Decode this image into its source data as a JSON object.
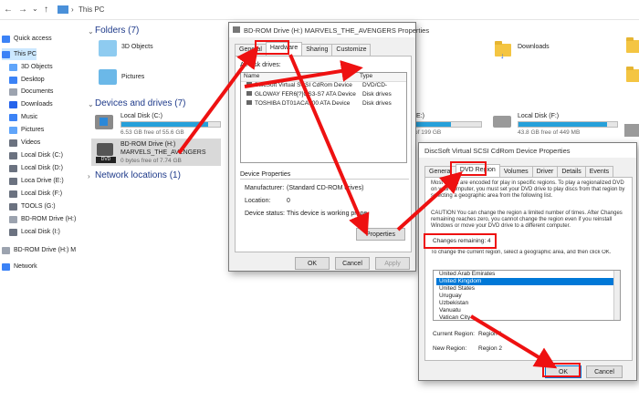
{
  "explorer": {
    "breadcrumb": "This PC",
    "sidebar": [
      {
        "label": "Quick access",
        "name": "sidebar-item-quick-access",
        "icon": "star-icon",
        "color": "#3b82f6"
      },
      {
        "label": "This PC",
        "name": "sidebar-item-this-pc",
        "icon": "pc-icon",
        "color": "#3b82f6",
        "selected": true
      },
      {
        "label": "3D Objects",
        "name": "sidebar-item-3d-objects",
        "icon": "cube-icon",
        "color": "#60a5fa"
      },
      {
        "label": "Desktop",
        "name": "sidebar-item-desktop",
        "icon": "desktop-icon",
        "color": "#3b82f6"
      },
      {
        "label": "Documents",
        "name": "sidebar-item-documents",
        "icon": "document-icon",
        "color": "#9ca3af"
      },
      {
        "label": "Downloads",
        "name": "sidebar-item-downloads",
        "icon": "download-icon",
        "color": "#2563eb"
      },
      {
        "label": "Music",
        "name": "sidebar-item-music",
        "icon": "music-icon",
        "color": "#3b82f6"
      },
      {
        "label": "Pictures",
        "name": "sidebar-item-pictures",
        "icon": "pictures-icon",
        "color": "#60a5fa"
      },
      {
        "label": "Videos",
        "name": "sidebar-item-videos",
        "icon": "video-icon",
        "color": "#6b7280"
      },
      {
        "label": "Local Disk (C:)",
        "name": "sidebar-item-local-c",
        "icon": "drive-icon",
        "color": "#6b7280"
      },
      {
        "label": "Local Disk (D:)",
        "name": "sidebar-item-local-d",
        "icon": "drive-icon",
        "color": "#6b7280"
      },
      {
        "label": "Loca Drive (E:)",
        "name": "sidebar-item-local-e",
        "icon": "drive-icon",
        "color": "#6b7280"
      },
      {
        "label": "Local Disk (F:)",
        "name": "sidebar-item-local-f",
        "icon": "drive-icon",
        "color": "#6b7280"
      },
      {
        "label": "TOOLS (G:)",
        "name": "sidebar-item-tools-g",
        "icon": "drive-icon",
        "color": "#6b7280"
      },
      {
        "label": "BD-ROM Drive (H:)",
        "name": "sidebar-item-bd-h",
        "icon": "disc-icon",
        "color": "#9ca3af"
      },
      {
        "label": "Local Disk (I:)",
        "name": "sidebar-item-local-i",
        "icon": "drive-icon",
        "color": "#6b7280"
      },
      {
        "label": "BD-ROM Drive (H:) M",
        "name": "sidebar-item-bd-h-2",
        "icon": "disc-icon",
        "color": "#9ca3af"
      },
      {
        "label": "Network",
        "name": "sidebar-item-network",
        "icon": "network-icon",
        "color": "#3b82f6"
      }
    ],
    "folders_head": "Folders (7)",
    "folders": [
      "3D Objects",
      "Pictures",
      "Downloads"
    ],
    "drives_head": "Devices and drives (7)",
    "drive_c": {
      "name": "Local Disk (C:)",
      "free": "6.53 GB free of 55.6 GB",
      "fill": 0.88
    },
    "drive_h": {
      "name": "BD-ROM Drive (H:)",
      "label": "MARVELS_THE_AVENGERS",
      "free": "0 bytes free of 7.74 GB",
      "badge": "DVD"
    },
    "drive_e": {
      "name": "E:)",
      "free": "of 199 GB",
      "fill": 0.55
    },
    "drive_f": {
      "name": "Local Disk (F:)",
      "free": "43.8 GB free of 449 MB",
      "fill": 0.9
    },
    "network_head": "Network locations (1)"
  },
  "props": {
    "title": "BD-ROM Drive (H:) MARVELS_THE_AVENGERS Properties",
    "tabs": [
      "General",
      "Hardware",
      "Sharing",
      "Customize"
    ],
    "all_drives": "All disk drives:",
    "col_name": "Name",
    "col_type": "Type",
    "rows": [
      {
        "name": "DiscSoft Virtual SCSI CdRom Device",
        "type": "DVD/CD-"
      },
      {
        "name": "GLOWAY FER6[?]GS3-S7 ATA Device",
        "type": "Disk drives"
      },
      {
        "name": "TOSHIBA DT01ACA100 ATA Device",
        "type": "Disk drives"
      }
    ],
    "device_props": "Device Properties",
    "manufacturer_label": "Manufacturer:",
    "manufacturer": "(Standard CD-ROM drives)",
    "location_label": "Location:",
    "location": "0",
    "status_label": "Device status:",
    "status": "This device is working prope",
    "properties_btn": "Properties",
    "ok": "OK",
    "cancel": "Cancel",
    "apply": "Apply"
  },
  "region": {
    "title": "DiscSoft Virtual SCSI CdRom Device Properties",
    "tabs": [
      "General",
      "DVD Region",
      "Volumes",
      "Driver",
      "Details",
      "Events"
    ],
    "desc": "Most DVDs are encoded for play in specific regions. To play a regionalized DVD on your computer, you must set your DVD drive to play discs from that region by selecting a geographic area from the following list.",
    "caution": "CAUTION   You can change the region a limited number of times. After Changes remaining reaches zero, you cannot change the region even if you reinstall Windows or move your DVD drive to a different computer.",
    "changes": "Changes remaining: 4",
    "instruction": "To change the current region, select a geographic area, and then click OK.",
    "regions": [
      "United Arab Emirates",
      "United Kingdom",
      "United States",
      "Uruguay",
      "Uzbekistan",
      "Vanuatu",
      "Vatican City"
    ],
    "current_label": "Current Region:",
    "current": "Region 1",
    "new_label": "New Region:",
    "new": "Region 2",
    "ok": "OK",
    "cancel": "Cancel"
  }
}
